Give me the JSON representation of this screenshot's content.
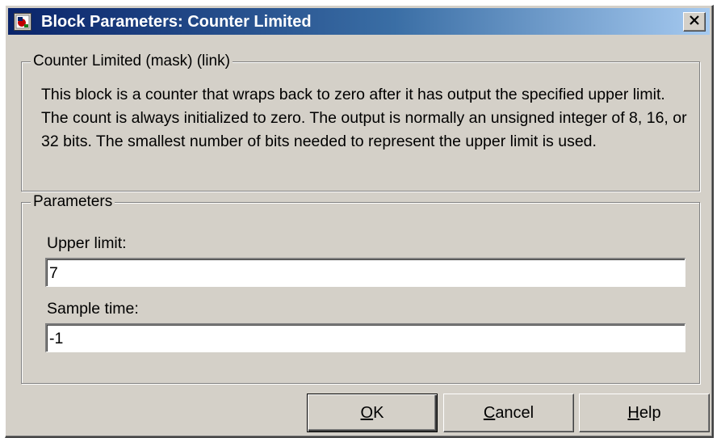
{
  "window": {
    "title": "Block Parameters: Counter Limited",
    "close_glyph": "✕"
  },
  "description": {
    "legend": "Counter Limited (mask) (link)",
    "text": "This block is a counter that wraps back to zero after it has output the specified upper limit.  The count is always initialized to zero.  The output is normally an unsigned integer of 8, 16, or 32 bits.  The smallest number of bits needed to represent the upper limit is used."
  },
  "parameters": {
    "legend": "Parameters",
    "upper_limit": {
      "label": "Upper limit:",
      "value": "7"
    },
    "sample_time": {
      "label": "Sample time:",
      "value": "-1"
    }
  },
  "buttons": {
    "ok": {
      "mnemonic": "O",
      "rest": "K"
    },
    "cancel": {
      "mnemonic": "C",
      "rest": "ancel"
    },
    "help": {
      "mnemonic": "H",
      "rest": "elp"
    }
  },
  "icons": {
    "title_icon": "simulink-block-icon",
    "close": "close-icon"
  },
  "colors": {
    "titlebar_start": "#0a246a",
    "titlebar_end": "#a6caf0",
    "dialog_face": "#d4d0c8"
  }
}
